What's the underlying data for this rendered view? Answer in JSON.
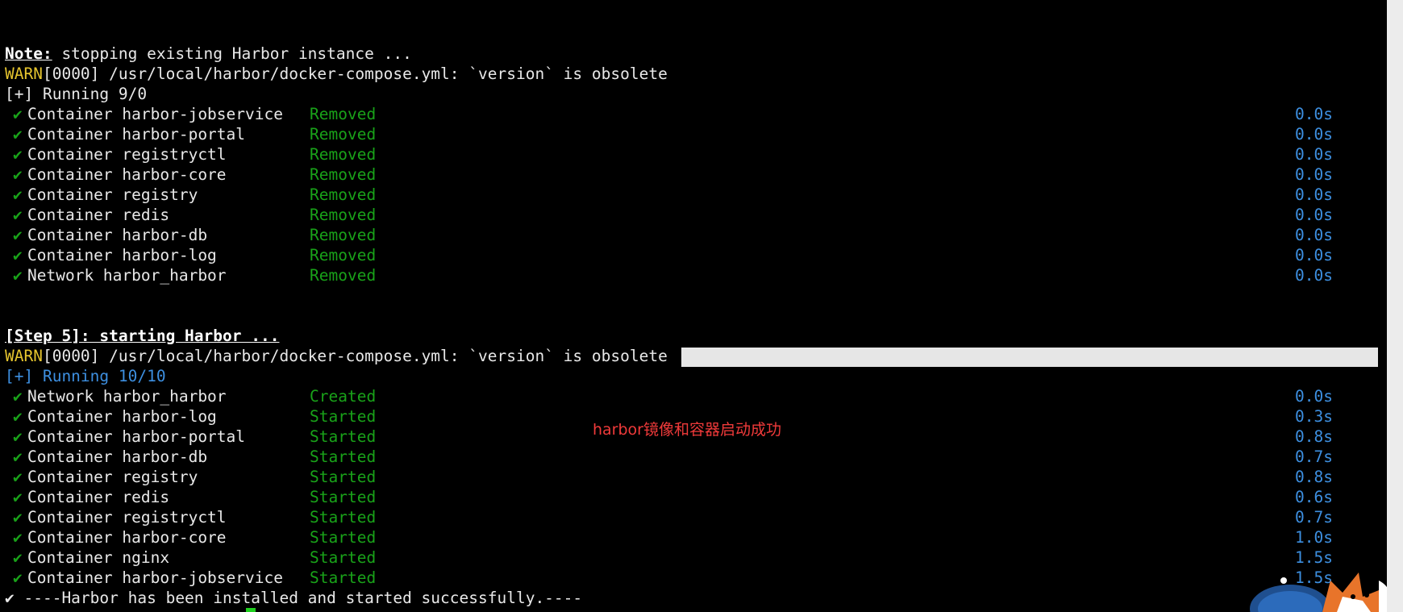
{
  "terminal": {
    "note_label": "Note:",
    "note_text": " stopping existing Harbor instance ...",
    "stop_warn": {
      "tag": "WARN",
      "text": "[0000] /usr/local/harbor/docker-compose.yml: `version` is obsolete"
    },
    "stop_running": "[+] Running 9/0",
    "stop_items": [
      {
        "name": "Container harbor-jobservice",
        "status": "Removed",
        "time": "0.0s"
      },
      {
        "name": "Container harbor-portal",
        "status": "Removed",
        "time": "0.0s"
      },
      {
        "name": "Container registryctl",
        "status": "Removed",
        "time": "0.0s"
      },
      {
        "name": "Container harbor-core",
        "status": "Removed",
        "time": "0.0s"
      },
      {
        "name": "Container registry",
        "status": "Removed",
        "time": "0.0s"
      },
      {
        "name": "Container redis",
        "status": "Removed",
        "time": "0.0s"
      },
      {
        "name": "Container harbor-db",
        "status": "Removed",
        "time": "0.0s"
      },
      {
        "name": "Container harbor-log",
        "status": "Removed",
        "time": "0.0s"
      },
      {
        "name": "Network harbor_harbor",
        "status": "Removed",
        "time": "0.0s"
      }
    ],
    "step5_label": "[Step 5]: starting Harbor ...",
    "start_warn": {
      "tag": "WARN",
      "text": "[0000] /usr/local/harbor/docker-compose.yml: `version` is obsolete"
    },
    "start_running": "[+] Running 10/10",
    "start_items": [
      {
        "name": "Network harbor_harbor",
        "status": "Created",
        "time": "0.0s"
      },
      {
        "name": "Container harbor-log",
        "status": "Started",
        "time": "0.3s"
      },
      {
        "name": "Container harbor-portal",
        "status": "Started",
        "time": "0.8s"
      },
      {
        "name": "Container harbor-db",
        "status": "Started",
        "time": "0.7s"
      },
      {
        "name": "Container registry",
        "status": "Started",
        "time": "0.8s"
      },
      {
        "name": "Container redis",
        "status": "Started",
        "time": "0.6s"
      },
      {
        "name": "Container registryctl",
        "status": "Started",
        "time": "0.7s"
      },
      {
        "name": "Container harbor-core",
        "status": "Started",
        "time": "1.0s"
      },
      {
        "name": "Container nginx",
        "status": "Started",
        "time": "1.5s"
      },
      {
        "name": "Container harbor-jobservice",
        "status": "Started",
        "time": "1.5s"
      }
    ],
    "success_line": "✔ ----Harbor has been installed and started successfully.----",
    "check_glyph": "✔"
  },
  "annotation": {
    "text": "harbor镜像和容器启动成功"
  },
  "colors": {
    "background": "#000000",
    "warn": "#e5c42e",
    "blue": "#3d8fe0",
    "green": "#19a219",
    "annotation": "#f03a3a"
  }
}
